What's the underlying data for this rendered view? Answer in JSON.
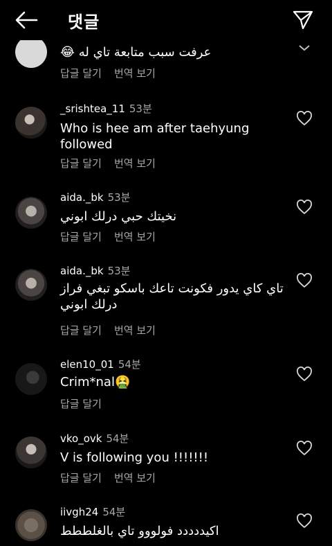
{
  "header": {
    "title": "댓글",
    "back_icon": "arrow-left-icon",
    "send_icon": "send-icon"
  },
  "comments": [
    {
      "username": "",
      "time": "",
      "text": "عرفت سبب متابعة تاي له 😂",
      "reply": "답글 달기",
      "translate": "번역 보기"
    },
    {
      "username": "_srishtea_11",
      "time": "53분",
      "text": "Who is hee am after taehyung followed",
      "reply": "답글 달기",
      "translate": "번역 보기"
    },
    {
      "username": "aida._bk",
      "time": "53분",
      "text": "نخيتك حبي درلك ابوني",
      "reply": "답글 달기",
      "translate": "번역 보기"
    },
    {
      "username": "aida._bk",
      "time": "53분",
      "text": "تاي كاي يدور فكونت تاعك باسكو تبغي فراز درلك ابوني",
      "reply": "답글 달기",
      "translate": "번역 보기"
    },
    {
      "username": "elen10_01",
      "time": "54분",
      "text": "Crim*nal🤮",
      "reply": "답글 달기"
    },
    {
      "username": "vko_ovk",
      "time": "54분",
      "text": "V is following you !!!!!!!",
      "reply": "답글 달기",
      "translate": "번역 보기"
    },
    {
      "username": "iivgh24",
      "time": "54분",
      "text": "اكيددددد فولووو تاي بالغلططط"
    }
  ],
  "colors": {
    "background": "#000000",
    "text": "#ffffff",
    "secondary": "#a8a8a8"
  }
}
